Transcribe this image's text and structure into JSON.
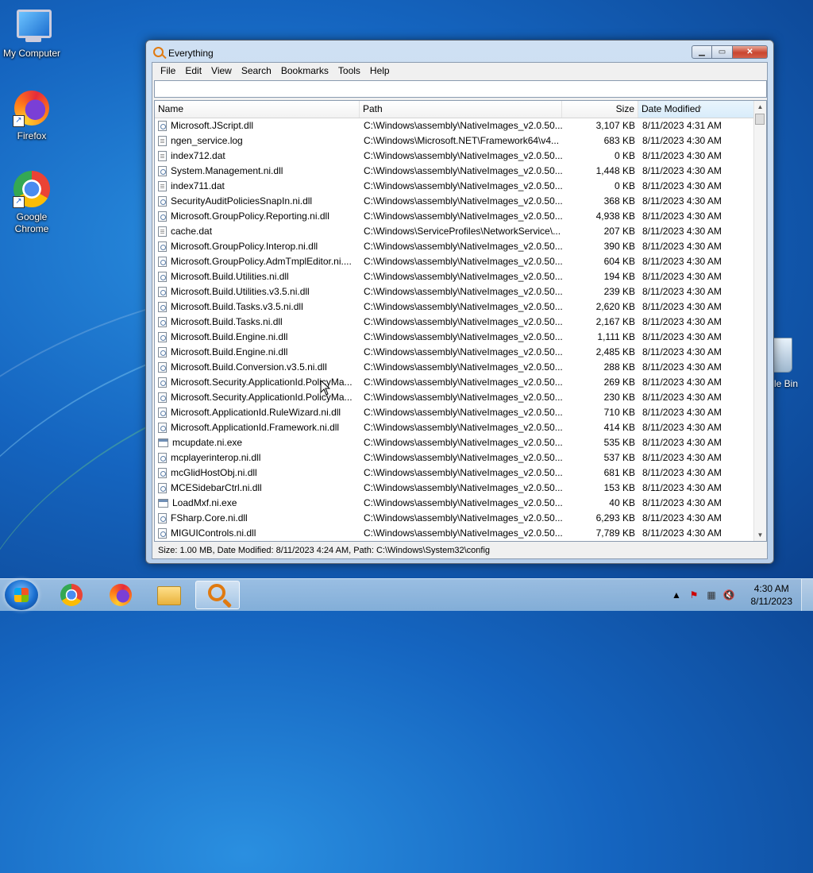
{
  "desktop": {
    "icons": [
      {
        "label": "My Computer"
      },
      {
        "label": "Firefox"
      },
      {
        "label": "Google Chrome"
      }
    ],
    "recycle_label": "le Bin"
  },
  "window": {
    "title": "Everything",
    "menu": [
      "File",
      "Edit",
      "View",
      "Search",
      "Bookmarks",
      "Tools",
      "Help"
    ],
    "search_value": "",
    "columns": {
      "name": "Name",
      "path": "Path",
      "size": "Size",
      "date": "Date Modified"
    },
    "rows": [
      {
        "icon": "dll",
        "name": "Microsoft.JScript.dll",
        "path": "C:\\Windows\\assembly\\NativeImages_v2.0.50...",
        "size": "3,107 KB",
        "date": "8/11/2023 4:31 AM"
      },
      {
        "icon": "txt",
        "name": "ngen_service.log",
        "path": "C:\\Windows\\Microsoft.NET\\Framework64\\v4...",
        "size": "683 KB",
        "date": "8/11/2023 4:30 AM"
      },
      {
        "icon": "txt",
        "name": "index712.dat",
        "path": "C:\\Windows\\assembly\\NativeImages_v2.0.50...",
        "size": "0 KB",
        "date": "8/11/2023 4:30 AM"
      },
      {
        "icon": "dll",
        "name": "System.Management.ni.dll",
        "path": "C:\\Windows\\assembly\\NativeImages_v2.0.50...",
        "size": "1,448 KB",
        "date": "8/11/2023 4:30 AM"
      },
      {
        "icon": "txt",
        "name": "index711.dat",
        "path": "C:\\Windows\\assembly\\NativeImages_v2.0.50...",
        "size": "0 KB",
        "date": "8/11/2023 4:30 AM"
      },
      {
        "icon": "dll",
        "name": "SecurityAuditPoliciesSnapIn.ni.dll",
        "path": "C:\\Windows\\assembly\\NativeImages_v2.0.50...",
        "size": "368 KB",
        "date": "8/11/2023 4:30 AM"
      },
      {
        "icon": "dll",
        "name": "Microsoft.GroupPolicy.Reporting.ni.dll",
        "path": "C:\\Windows\\assembly\\NativeImages_v2.0.50...",
        "size": "4,938 KB",
        "date": "8/11/2023 4:30 AM"
      },
      {
        "icon": "txt",
        "name": "cache.dat",
        "path": "C:\\Windows\\ServiceProfiles\\NetworkService\\...",
        "size": "207 KB",
        "date": "8/11/2023 4:30 AM"
      },
      {
        "icon": "dll",
        "name": "Microsoft.GroupPolicy.Interop.ni.dll",
        "path": "C:\\Windows\\assembly\\NativeImages_v2.0.50...",
        "size": "390 KB",
        "date": "8/11/2023 4:30 AM"
      },
      {
        "icon": "dll",
        "name": "Microsoft.GroupPolicy.AdmTmplEditor.ni....",
        "path": "C:\\Windows\\assembly\\NativeImages_v2.0.50...",
        "size": "604 KB",
        "date": "8/11/2023 4:30 AM"
      },
      {
        "icon": "dll",
        "name": "Microsoft.Build.Utilities.ni.dll",
        "path": "C:\\Windows\\assembly\\NativeImages_v2.0.50...",
        "size": "194 KB",
        "date": "8/11/2023 4:30 AM"
      },
      {
        "icon": "dll",
        "name": "Microsoft.Build.Utilities.v3.5.ni.dll",
        "path": "C:\\Windows\\assembly\\NativeImages_v2.0.50...",
        "size": "239 KB",
        "date": "8/11/2023 4:30 AM"
      },
      {
        "icon": "dll",
        "name": "Microsoft.Build.Tasks.v3.5.ni.dll",
        "path": "C:\\Windows\\assembly\\NativeImages_v2.0.50...",
        "size": "2,620 KB",
        "date": "8/11/2023 4:30 AM"
      },
      {
        "icon": "dll",
        "name": "Microsoft.Build.Tasks.ni.dll",
        "path": "C:\\Windows\\assembly\\NativeImages_v2.0.50...",
        "size": "2,167 KB",
        "date": "8/11/2023 4:30 AM"
      },
      {
        "icon": "dll",
        "name": "Microsoft.Build.Engine.ni.dll",
        "path": "C:\\Windows\\assembly\\NativeImages_v2.0.50...",
        "size": "1,111 KB",
        "date": "8/11/2023 4:30 AM"
      },
      {
        "icon": "dll",
        "name": "Microsoft.Build.Engine.ni.dll",
        "path": "C:\\Windows\\assembly\\NativeImages_v2.0.50...",
        "size": "2,485 KB",
        "date": "8/11/2023 4:30 AM"
      },
      {
        "icon": "dll",
        "name": "Microsoft.Build.Conversion.v3.5.ni.dll",
        "path": "C:\\Windows\\assembly\\NativeImages_v2.0.50...",
        "size": "288 KB",
        "date": "8/11/2023 4:30 AM"
      },
      {
        "icon": "dll",
        "name": "Microsoft.Security.ApplicationId.PolicyMa...",
        "path": "C:\\Windows\\assembly\\NativeImages_v2.0.50...",
        "size": "269 KB",
        "date": "8/11/2023 4:30 AM"
      },
      {
        "icon": "dll",
        "name": "Microsoft.Security.ApplicationId.PolicyMa...",
        "path": "C:\\Windows\\assembly\\NativeImages_v2.0.50...",
        "size": "230 KB",
        "date": "8/11/2023 4:30 AM"
      },
      {
        "icon": "dll",
        "name": "Microsoft.ApplicationId.RuleWizard.ni.dll",
        "path": "C:\\Windows\\assembly\\NativeImages_v2.0.50...",
        "size": "710 KB",
        "date": "8/11/2023 4:30 AM"
      },
      {
        "icon": "dll",
        "name": "Microsoft.ApplicationId.Framework.ni.dll",
        "path": "C:\\Windows\\assembly\\NativeImages_v2.0.50...",
        "size": "414 KB",
        "date": "8/11/2023 4:30 AM"
      },
      {
        "icon": "exe",
        "name": "mcupdate.ni.exe",
        "path": "C:\\Windows\\assembly\\NativeImages_v2.0.50...",
        "size": "535 KB",
        "date": "8/11/2023 4:30 AM"
      },
      {
        "icon": "dll",
        "name": "mcplayerinterop.ni.dll",
        "path": "C:\\Windows\\assembly\\NativeImages_v2.0.50...",
        "size": "537 KB",
        "date": "8/11/2023 4:30 AM"
      },
      {
        "icon": "dll",
        "name": "mcGlidHostObj.ni.dll",
        "path": "C:\\Windows\\assembly\\NativeImages_v2.0.50...",
        "size": "681 KB",
        "date": "8/11/2023 4:30 AM"
      },
      {
        "icon": "dll",
        "name": "MCESidebarCtrl.ni.dll",
        "path": "C:\\Windows\\assembly\\NativeImages_v2.0.50...",
        "size": "153 KB",
        "date": "8/11/2023 4:30 AM"
      },
      {
        "icon": "exe",
        "name": "LoadMxf.ni.exe",
        "path": "C:\\Windows\\assembly\\NativeImages_v2.0.50...",
        "size": "40 KB",
        "date": "8/11/2023 4:30 AM"
      },
      {
        "icon": "dll",
        "name": "FSharp.Core.ni.dll",
        "path": "C:\\Windows\\assembly\\NativeImages_v2.0.50...",
        "size": "6,293 KB",
        "date": "8/11/2023 4:30 AM"
      },
      {
        "icon": "dll",
        "name": "MIGUIControls.ni.dll",
        "path": "C:\\Windows\\assembly\\NativeImages_v2.0.50...",
        "size": "7,789 KB",
        "date": "8/11/2023 4:30 AM"
      }
    ],
    "status": "Size: 1.00 MB, Date Modified: 8/11/2023 4:24 AM, Path: C:\\Windows\\System32\\config"
  },
  "taskbar": {
    "clock_time": "4:30 AM",
    "clock_date": "8/11/2023"
  }
}
